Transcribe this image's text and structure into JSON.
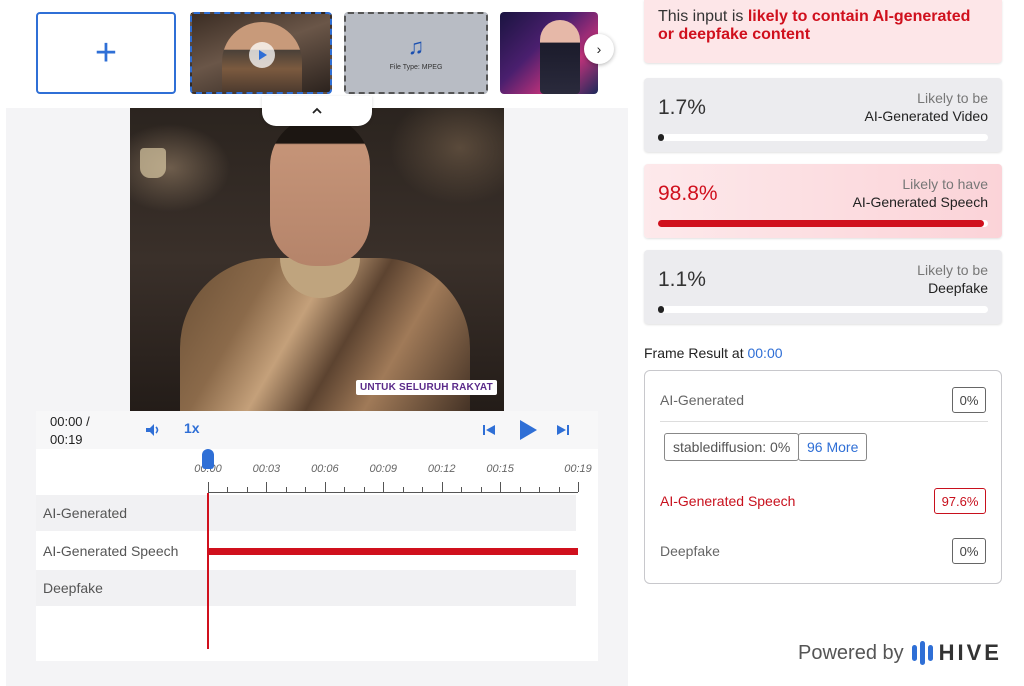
{
  "upload": {
    "add_icon": "plus-icon"
  },
  "thumbnails": {
    "audio_file_type": "File Type: MPEG",
    "next_icon": "chevron-right-icon"
  },
  "video": {
    "caption": "UNTUK SELURUH RAKYAT",
    "collapse_icon": "chevron-up-icon"
  },
  "player": {
    "current_time": "00:00 /",
    "duration": "00:19",
    "speed": "1x",
    "icons": [
      "volume-icon",
      "skip-back-icon",
      "play-icon",
      "skip-forward-icon"
    ]
  },
  "timeline": {
    "ticks": [
      "00:00",
      "00:03",
      "00:06",
      "00:09",
      "00:12",
      "00:15",
      "00:19"
    ],
    "tracks": [
      {
        "label": "AI-Generated",
        "flag_start": null,
        "flag_end": null
      },
      {
        "label": "AI-Generated Speech",
        "flag_start": "00:00",
        "flag_end": "00:19"
      },
      {
        "label": "Deepfake",
        "flag_start": null,
        "flag_end": null
      }
    ]
  },
  "verdict": {
    "prefix": "This input is ",
    "highlight": "likely to contain AI-generated or deepfake content"
  },
  "scores": [
    {
      "percent": "1.7%",
      "value": 0.017,
      "line1": "Likely to be",
      "line2": "AI-Generated Video",
      "alert": false
    },
    {
      "percent": "98.8%",
      "value": 0.988,
      "line1": "Likely to have",
      "line2": "AI-Generated Speech",
      "alert": true
    },
    {
      "percent": "1.1%",
      "value": 0.011,
      "line1": "Likely to be",
      "line2": "Deepfake",
      "alert": false
    }
  ],
  "frame_result": {
    "title": "Frame Result at ",
    "timestamp": "00:00",
    "ai_generated_label": "AI-Generated",
    "ai_generated_value": "0%",
    "chip_label": "stablediffusion: 0%",
    "more_label": "96 More",
    "speech_label": "AI-Generated Speech",
    "speech_value": "97.6%",
    "deepfake_label": "Deepfake",
    "deepfake_value": "0%"
  },
  "footer": {
    "powered_by": "Powered by",
    "brand": "HIVE"
  },
  "colors": {
    "accent": "#2f6fd6",
    "alert": "#d0101d"
  }
}
